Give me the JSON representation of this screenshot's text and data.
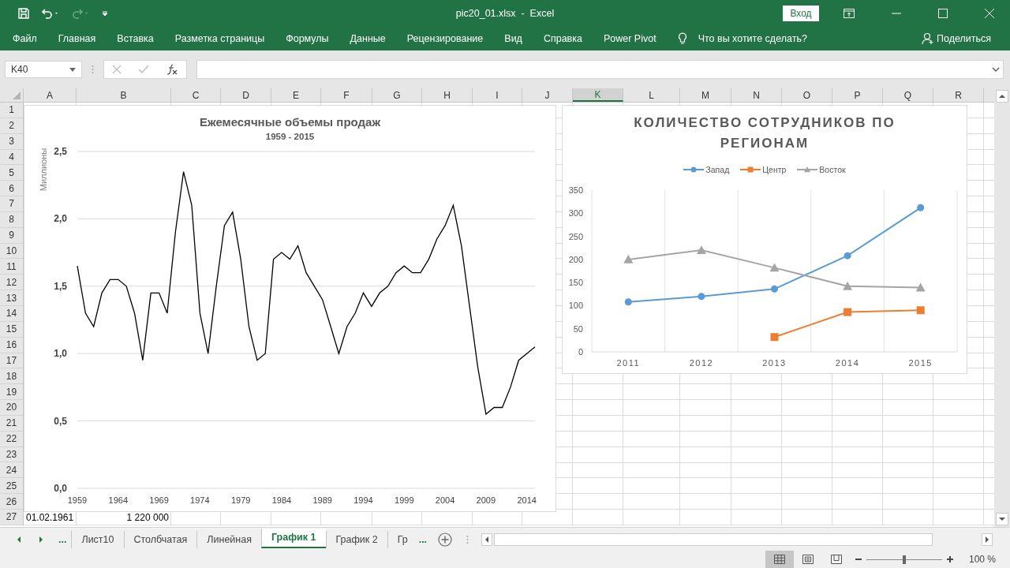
{
  "title_bar": {
    "title": "pic20_01.xlsx  -  Excel",
    "sign_in": "Вход"
  },
  "ribbon_tabs": [
    "Файл",
    "Главная",
    "Вставка",
    "Разметка страницы",
    "Формулы",
    "Данные",
    "Рецензирование",
    "Вид",
    "Справка",
    "Power Pivot"
  ],
  "tell_me": "Что вы хотите сделать?",
  "share": "Поделиться",
  "formula_bar": {
    "name_box": "K40"
  },
  "columns": [
    {
      "label": "A",
      "selected": false
    },
    {
      "label": "B",
      "selected": false
    },
    {
      "label": "C",
      "selected": false
    },
    {
      "label": "D",
      "selected": false
    },
    {
      "label": "E",
      "selected": false
    },
    {
      "label": "F",
      "selected": false
    },
    {
      "label": "G",
      "selected": false
    },
    {
      "label": "H",
      "selected": false
    },
    {
      "label": "I",
      "selected": false
    },
    {
      "label": "J",
      "selected": false
    },
    {
      "label": "K",
      "selected": true
    },
    {
      "label": "L",
      "selected": false
    },
    {
      "label": "M",
      "selected": false
    },
    {
      "label": "N",
      "selected": false
    },
    {
      "label": "O",
      "selected": false
    },
    {
      "label": "P",
      "selected": false
    },
    {
      "label": "Q",
      "selected": false
    },
    {
      "label": "R",
      "selected": false
    }
  ],
  "rows": [
    "1",
    "2",
    "3",
    "4",
    "5",
    "6",
    "7",
    "8",
    "9",
    "10",
    "11",
    "12",
    "13",
    "14",
    "15",
    "16",
    "17",
    "18",
    "19",
    "20",
    "21",
    "22",
    "23",
    "24",
    "25",
    "26",
    "27"
  ],
  "row_27": {
    "column_a": "01.02.1961",
    "column_b": "1 220 000"
  },
  "charts": [
    {
      "subtitle": "1959 - 2015",
      "chart_data": {
        "type": "line",
        "title": "Ежемесячные объемы продаж",
        "ylabel": "Миллионы",
        "grid": true,
        "x": [
          1959,
          1960,
          1961,
          1962,
          1963,
          1964,
          1965,
          1966,
          1967,
          1968,
          1969,
          1970,
          1971,
          1972,
          1973,
          1974,
          1975,
          1976,
          1977,
          1978,
          1979,
          1980,
          1981,
          1982,
          1983,
          1984,
          1985,
          1986,
          1987,
          1988,
          1989,
          1990,
          1991,
          1992,
          1993,
          1994,
          1995,
          1996,
          1997,
          1998,
          1999,
          2000,
          2001,
          2002,
          2003,
          2004,
          2005,
          2006,
          2007,
          2008,
          2009,
          2010,
          2011,
          2012,
          2013,
          2014,
          2015
        ],
        "xlim": [
          1959,
          2015
        ],
        "xticks": [
          1959,
          1964,
          1969,
          1974,
          1979,
          1984,
          1989,
          1994,
          1999,
          2004,
          2009,
          2014
        ],
        "ylim": [
          0,
          2.5
        ],
        "yticks": [
          {
            "value": 0,
            "label": "0,0"
          },
          {
            "value": 0.5,
            "label": "0,5"
          },
          {
            "value": 1,
            "label": "1,0"
          },
          {
            "value": 1.5,
            "label": "1,5"
          },
          {
            "value": 2,
            "label": "2,0"
          },
          {
            "value": 2.5,
            "label": "2,5"
          }
        ],
        "series": [
          {
            "color": "#000000",
            "values": [
              1.65,
              1.3,
              1.2,
              1.45,
              1.55,
              1.55,
              1.5,
              1.3,
              0.95,
              1.45,
              1.45,
              1.3,
              1.9,
              2.35,
              2.1,
              1.3,
              1.0,
              1.5,
              1.95,
              2.05,
              1.7,
              1.2,
              0.95,
              1.0,
              1.7,
              1.75,
              1.7,
              1.8,
              1.6,
              1.5,
              1.4,
              1.2,
              1.0,
              1.2,
              1.3,
              1.45,
              1.35,
              1.45,
              1.5,
              1.6,
              1.65,
              1.6,
              1.6,
              1.7,
              1.85,
              1.95,
              2.1,
              1.8,
              1.35,
              0.9,
              0.55,
              0.6,
              0.6,
              0.75,
              0.95,
              1.0,
              1.05
            ]
          }
        ]
      }
    },
    {
      "chart_data": {
        "type": "line",
        "title": "КОЛИЧЕСТВО СОТРУДНИКОВ ПО РЕГИОНАМ",
        "legend": true,
        "grid": true,
        "categories": [
          "2011",
          "2012",
          "2013",
          "2014",
          "2015"
        ],
        "ylim": [
          0,
          350
        ],
        "yticks": [
          0,
          50,
          100,
          150,
          200,
          250,
          300,
          350
        ],
        "series": [
          {
            "name": "Запад",
            "color": "#5b9bd5",
            "marker": "circle",
            "values": [
              108,
              120,
              136,
              208,
              312
            ]
          },
          {
            "name": "Центр",
            "color": "#ed7d31",
            "marker": "square",
            "values": [
              null,
              null,
              32,
              86,
              90
            ]
          },
          {
            "name": "Восток",
            "color": "#a5a5a5",
            "marker": "triangle",
            "values": [
              200,
              220,
              182,
              142,
              139
            ]
          }
        ]
      }
    }
  ],
  "sheet_tabs": [
    {
      "label": "Лист10",
      "selected": false
    },
    {
      "label": "Столбчатая",
      "selected": false
    },
    {
      "label": "Линейная",
      "selected": false
    },
    {
      "label": "График 1",
      "selected": true
    },
    {
      "label": "График 2",
      "selected": false
    },
    {
      "label": "Гр",
      "selected": false
    }
  ],
  "sheet_nav_more": [
    "...",
    "..."
  ],
  "status_bar": {
    "views": [
      {
        "kind": "normal",
        "selected": true
      },
      {
        "kind": "page_layout",
        "selected": false
      },
      {
        "kind": "page_break",
        "selected": false
      }
    ],
    "zoom": {
      "level": 0.5,
      "reading": "100 %"
    }
  }
}
